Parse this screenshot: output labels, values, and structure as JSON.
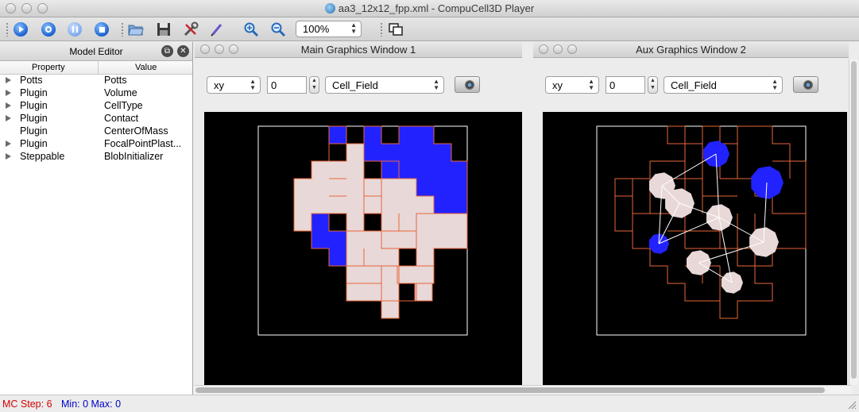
{
  "window": {
    "title": "aa3_12x12_fpp.xml - CompuCell3D Player"
  },
  "toolbar": {
    "icons": [
      "run-icon",
      "step-icon",
      "pause-icon",
      "stop-icon",
      "open-icon",
      "save-icon",
      "tools-icon",
      "edit-icon",
      "zoom-in-icon",
      "zoom-out-icon",
      "view-layout-icon"
    ],
    "zoom_value": "100%"
  },
  "model_editor": {
    "title": "Model Editor",
    "col_property": "Property",
    "col_value": "Value",
    "rows": [
      {
        "property": "Potts",
        "value": "Potts",
        "expandable": true
      },
      {
        "property": "Plugin",
        "value": "Volume",
        "expandable": true
      },
      {
        "property": "Plugin",
        "value": "CellType",
        "expandable": true
      },
      {
        "property": "Plugin",
        "value": "Contact",
        "expandable": true
      },
      {
        "property": "Plugin",
        "value": "CenterOfMass",
        "expandable": false
      },
      {
        "property": "Plugin",
        "value": "FocalPointPlast...",
        "expandable": true
      },
      {
        "property": "Steppable",
        "value": "BlobInitializer",
        "expandable": true
      }
    ]
  },
  "main_window": {
    "title": "Main Graphics Window 1",
    "plane": "xy",
    "position": "0",
    "field": "Cell_Field"
  },
  "aux_window": {
    "title": "Aux Graphics Window 2",
    "plane": "xy",
    "position": "0",
    "field": "Cell_Field"
  },
  "colors": {
    "medium": "#000000",
    "cell_type_1": "#2222ff",
    "cell_type_2": "#e8d8d8",
    "cell_border": "#e8663a",
    "fpp_link": "#ffffff",
    "status_step": "#d40000",
    "status_minmax": "#0000c8"
  },
  "status": {
    "mc_step_label": "MC Step: 6",
    "min_max_label": "Min: 0 Max: 0"
  }
}
